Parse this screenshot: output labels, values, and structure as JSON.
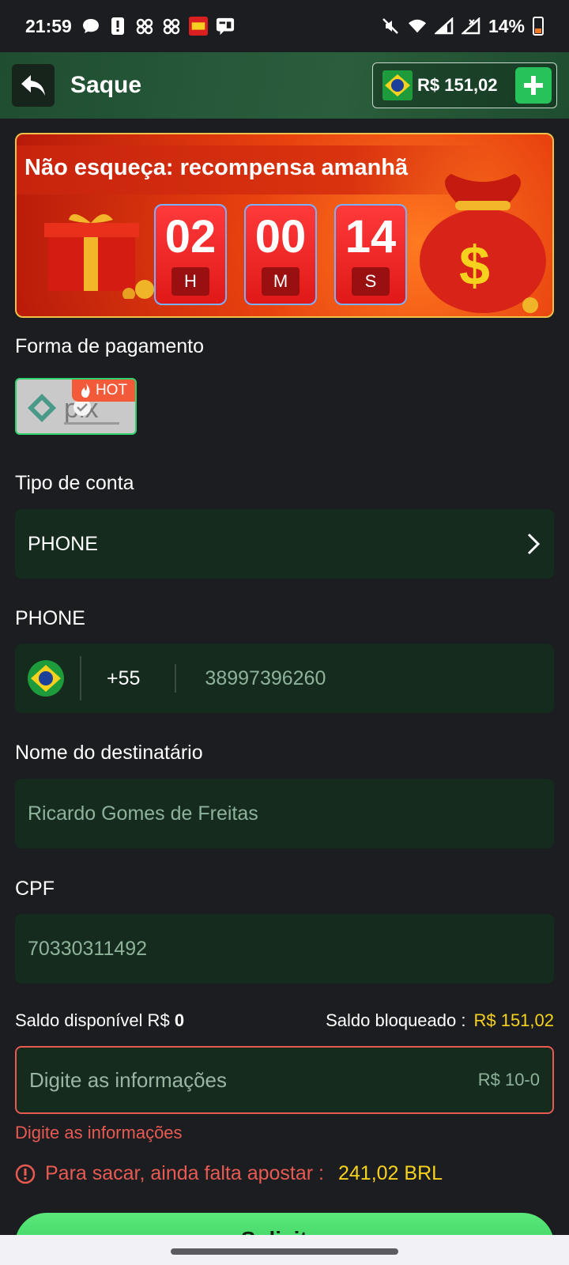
{
  "status_bar": {
    "time": "21:59",
    "battery": "14%",
    "icons": [
      "chat-bubble-icon",
      "alert-icon",
      "cat-icon",
      "cat-icon",
      "game-app-icon",
      "message-icon"
    ],
    "right_icons": [
      "mute-icon",
      "wifi-icon",
      "signal-icon",
      "signal-icon"
    ]
  },
  "header": {
    "title": "Saque",
    "balance": "R$ 151,02"
  },
  "banner": {
    "title": "Não esqueça: recompensa amanhã",
    "hours": "02",
    "hours_unit": "H",
    "minutes": "00",
    "minutes_unit": "M",
    "seconds": "14",
    "seconds_unit": "S"
  },
  "payment": {
    "label": "Forma de pagamento",
    "method_badge": "HOT"
  },
  "account_type": {
    "label": "Tipo de conta",
    "value": "PHONE"
  },
  "phone": {
    "label": "PHONE",
    "country_code": "+55",
    "number": "38997396260"
  },
  "recipient": {
    "label": "Nome do destinatário",
    "value": "Ricardo Gomes de Freitas"
  },
  "cpf": {
    "label": "CPF",
    "value": "70330311492"
  },
  "saldo": {
    "available_label": "Saldo disponível R$",
    "available_value": "0",
    "blocked_label": "Saldo bloqueado :",
    "blocked_value": "R$ 151,02"
  },
  "amount": {
    "placeholder": "Digite as informações",
    "range": "R$ 10-0",
    "error": "Digite as informações"
  },
  "warning": {
    "text": "Para sacar, ainda falta apostar :",
    "amount": "241,02 BRL"
  },
  "submit": {
    "label": "Solicitar"
  },
  "colors": {
    "accent_green": "#27c25a",
    "error_red": "#e85a52",
    "highlight_yellow": "#f6d21e",
    "field_bg": "#142b1e"
  }
}
